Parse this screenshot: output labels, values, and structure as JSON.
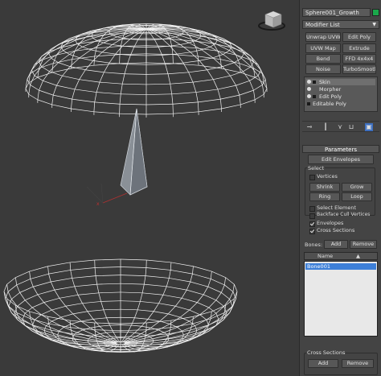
{
  "object_name": "Sphere001_Growth",
  "object_color": "#1aa84b",
  "modifier_list_label": "Modifier List",
  "modifier_buttons": [
    "Unwrap UVW",
    "Edit Poly",
    "UVW Map",
    "Extrude",
    "Bend",
    "FFD 4x4x4",
    "Noise",
    "TurboSmooth"
  ],
  "stack": [
    {
      "label": "Skin",
      "active": true
    },
    {
      "label": "Morpher",
      "active": false
    },
    {
      "label": "Edit Poly",
      "active": false
    },
    {
      "label": "Editable Poly",
      "active": false
    }
  ],
  "parameters": {
    "title": "Parameters",
    "edit_envelopes": "Edit Envelopes",
    "select_label": "Select",
    "vertices_label": "Vertices",
    "shrink": "Shrink",
    "grow": "Grow",
    "ring": "Ring",
    "loop": "Loop",
    "select_element": "Select Element",
    "backface_cull": "Backface Cull Vertices",
    "envelopes": "Envelopes",
    "cross_sections": "Cross Sections"
  },
  "bones": {
    "label": "Bones:",
    "add": "Add",
    "remove": "Remove",
    "name_header": "Name",
    "items": [
      "Bone001"
    ]
  },
  "cross_sections_group": {
    "title": "Cross Sections",
    "add": "Add",
    "remove": "Remove"
  }
}
